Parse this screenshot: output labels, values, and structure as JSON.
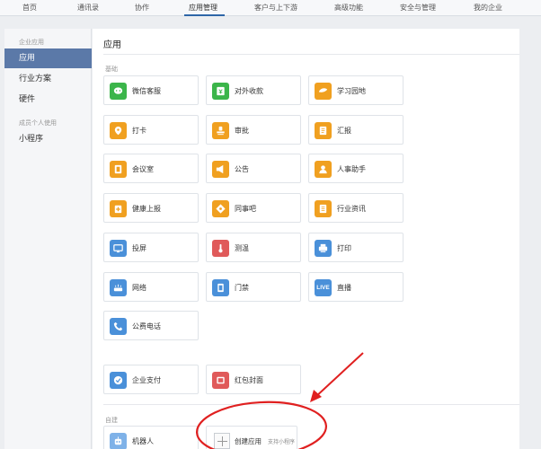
{
  "topnav": {
    "items": [
      {
        "label": "首页"
      },
      {
        "label": "通讯录"
      },
      {
        "label": "协作"
      },
      {
        "label": "应用管理"
      },
      {
        "label": "客户与上下游"
      },
      {
        "label": "高级功能"
      },
      {
        "label": "安全与管理"
      },
      {
        "label": "我的企业"
      }
    ],
    "active_index": 3
  },
  "sidebar": {
    "group_enterprise": "企业应用",
    "items_enterprise": [
      {
        "label": "应用"
      },
      {
        "label": "行业方案"
      },
      {
        "label": "硬件"
      }
    ],
    "group_personal": "成员个人使用",
    "items_personal": [
      {
        "label": "小程序"
      }
    ]
  },
  "main": {
    "title": "应用",
    "section_basic": "基础",
    "section_custom": "自建",
    "apps": [
      {
        "label": "微信客服",
        "icon": "wechat-service-icon",
        "color": "#3bb54a"
      },
      {
        "label": "对外收款",
        "icon": "payment-icon",
        "color": "#3bb54a"
      },
      {
        "label": "学习园地",
        "icon": "learning-icon",
        "color": "#f0a020"
      },
      {
        "label": "打卡",
        "icon": "checkin-icon",
        "color": "#f0a020"
      },
      {
        "label": "审批",
        "icon": "approval-icon",
        "color": "#f0a020"
      },
      {
        "label": "汇报",
        "icon": "report-icon",
        "color": "#f0a020"
      },
      {
        "label": "会议室",
        "icon": "meeting-room-icon",
        "color": "#f0a020"
      },
      {
        "label": "公告",
        "icon": "announcement-icon",
        "color": "#f0a020"
      },
      {
        "label": "人事助手",
        "icon": "hr-assistant-icon",
        "color": "#f0a020"
      },
      {
        "label": "健康上报",
        "icon": "health-report-icon",
        "color": "#f0a020"
      },
      {
        "label": "同事吧",
        "icon": "colleague-icon",
        "color": "#f0a020"
      },
      {
        "label": "行业资讯",
        "icon": "industry-news-icon",
        "color": "#f0a020"
      },
      {
        "label": "投屏",
        "icon": "screen-cast-icon",
        "color": "#4a90d9"
      },
      {
        "label": "测温",
        "icon": "thermometer-icon",
        "color": "#e05a5a"
      },
      {
        "label": "打印",
        "icon": "printer-icon",
        "color": "#4a90d9"
      },
      {
        "label": "网络",
        "icon": "network-icon",
        "color": "#4a90d9"
      },
      {
        "label": "门禁",
        "icon": "door-access-icon",
        "color": "#4a90d9"
      },
      {
        "label": "直播",
        "icon": "live-icon",
        "color": "#4a90d9",
        "icon_text": "LIVE"
      },
      {
        "label": "公费电话",
        "icon": "phone-icon",
        "color": "#4a90d9"
      }
    ],
    "apps_extra": [
      {
        "label": "企业支付",
        "icon": "enterprise-pay-icon",
        "color": "#4a90d9"
      },
      {
        "label": "红包封面",
        "icon": "red-packet-icon",
        "color": "#e05a5a"
      }
    ],
    "custom_apps": [
      {
        "label": "机器人",
        "icon": "robot-icon",
        "color": "#7fb2e8"
      }
    ],
    "create_app": {
      "label": "创建应用",
      "sub": "支持小程序"
    }
  },
  "colors": {
    "accent": "#2e66a8",
    "sidebar_active": "#5b79a8",
    "annotation": "#e02020"
  }
}
